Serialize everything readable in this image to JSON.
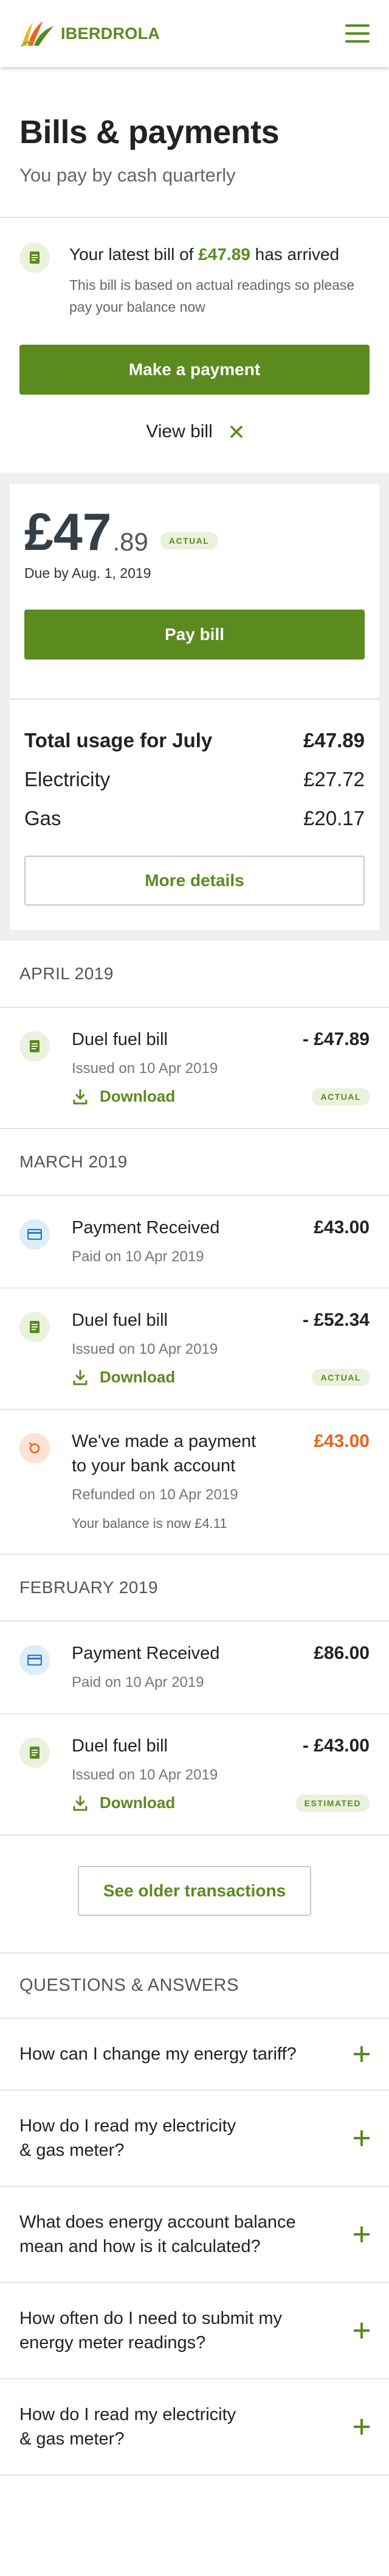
{
  "header": {
    "brand": "IBERDROLA",
    "menu_icon": "hamburger-menu-icon",
    "brand_colors": [
      "#5b8a1f",
      "#f2b21c",
      "#e8641e"
    ]
  },
  "page": {
    "title": "Bills & payments",
    "subtitle": "You pay by cash quarterly"
  },
  "notice": {
    "icon": "document-icon",
    "title_prefix": "Your latest bill of ",
    "title_amount": "£47.89",
    "title_suffix": " has arrived",
    "description": "This bill is based on actual readings so please pay your balance now",
    "make_payment_label": "Make a payment",
    "view_bill_label": "View bill",
    "close_icon": "close-icon"
  },
  "bill": {
    "amount_main": "£47",
    "amount_pence": ".89",
    "status_tag": "ACTUAL",
    "due": "Due by Aug. 1, 2019",
    "pay_label": "Pay bill",
    "usage_label": "Total usage for July",
    "usage_total": "£47.89",
    "electricity_label": "Electricity",
    "electricity_amount": "£27.72",
    "gas_label": "Gas",
    "gas_amount": "£20.17",
    "more_details_label": "More details"
  },
  "transactions": {
    "april": {
      "heading": "APRIL 2019",
      "bill": {
        "title": "Duel fuel bill",
        "amount": "- £47.89",
        "meta": "Issued on 10 Apr 2019",
        "download": "Download",
        "tag": "ACTUAL"
      }
    },
    "march": {
      "heading": "MARCH 2019",
      "payment": {
        "title": "Payment Received",
        "amount": "£43.00",
        "meta": "Paid on 10 Apr 2019"
      },
      "bill": {
        "title": "Duel fuel bill",
        "amount": "- £52.34",
        "meta": "Issued on 10 Apr 2019",
        "download": "Download",
        "tag": "ACTUAL"
      },
      "refund": {
        "title": "We've made a payment to your bank account",
        "amount": "£43.00",
        "meta": "Refunded on 10 Apr 2019",
        "balance": "Your balance is now £4.11"
      }
    },
    "february": {
      "heading": "FEBRUARY 2019",
      "payment": {
        "title": "Payment Received",
        "amount": "£86.00",
        "meta": "Paid on 10 Apr 2019"
      },
      "bill": {
        "title": "Duel fuel bill",
        "amount": "- £43.00",
        "meta": "Issued on 10 Apr 2019",
        "download": "Download",
        "tag": "ESTIMATED"
      }
    },
    "older_label": "See older transactions"
  },
  "qa": {
    "heading": "QUESTIONS & ANSWERS",
    "items": [
      "How can I change my energy tariff?",
      "How do I read my electricity & gas meter?",
      "What does energy account balance mean and how is it calculated?",
      "How often do I need to submit my energy meter readings?",
      "How do I read my electricity & gas meter?"
    ]
  }
}
